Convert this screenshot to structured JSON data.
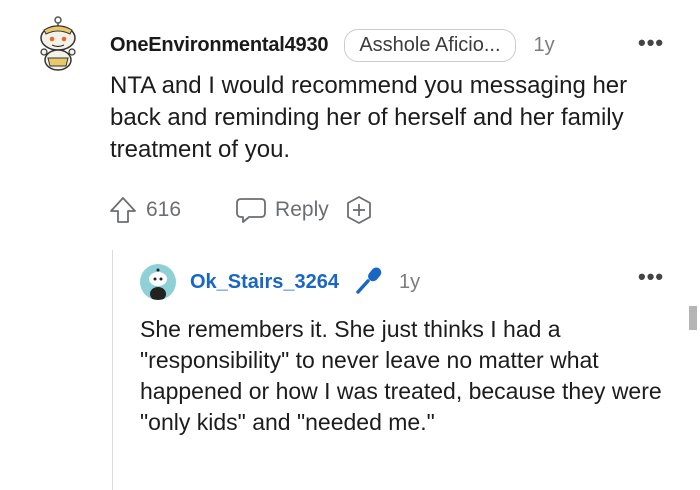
{
  "comment": {
    "username": "OneEnvironmental4930",
    "flair": "Asshole Aficio...",
    "time": "1y",
    "more_label": "•••",
    "body": "NTA and I would recommend you messaging her back and reminding her of herself and her family treatment of you.",
    "score": "616",
    "reply_label": "Reply"
  },
  "reply": {
    "username": "Ok_Stairs_3264",
    "time": "1y",
    "more_label": "•••",
    "body": "She remembers it. She just thinks I had a \"responsibility\" to never leave no matter what happened or how I was treated, because they were \"only kids\" and \"needed me.\""
  },
  "icons": {
    "upvote": "upvote-arrow-icon",
    "reply": "speech-bubble-icon",
    "award": "add-award-icon",
    "mic": "microphone-icon",
    "avatar1": "snoo-avatar-icon",
    "avatar2": "snoo-avatar-icon"
  },
  "colors": {
    "username_reply": "#1a66c4",
    "mic": "#1a66c4",
    "avatar2_bg": "#8fd0d6"
  }
}
